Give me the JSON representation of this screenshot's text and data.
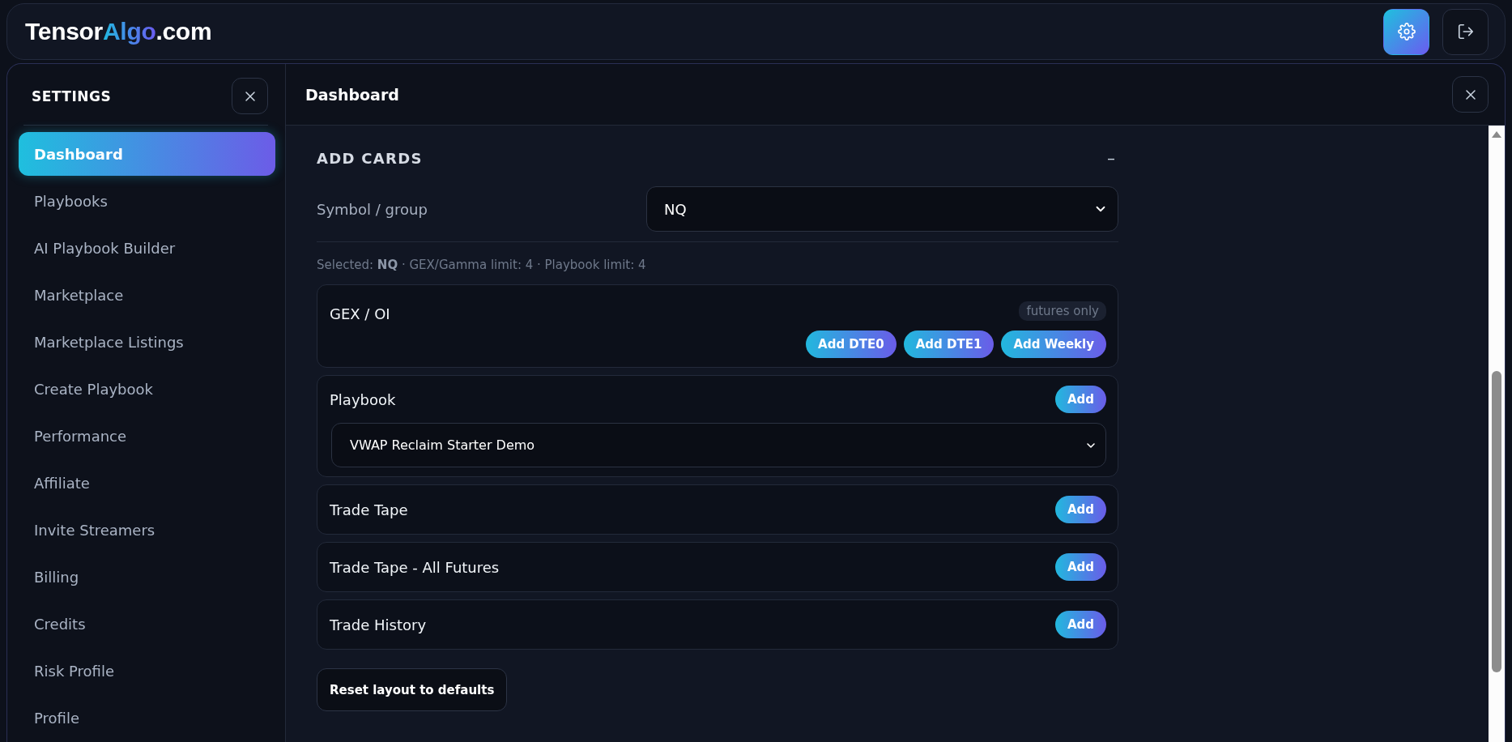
{
  "header": {
    "logo": [
      {
        "text": "Tensor",
        "kind": "plain"
      },
      {
        "text": "Algo",
        "kind": "accent"
      },
      {
        "text": ".com",
        "kind": "plain"
      }
    ],
    "buttons": [
      {
        "kind": "settings",
        "selected": true
      },
      {
        "kind": "logout",
        "selected": false
      }
    ]
  },
  "sidebar": {
    "title": "SETTINGS",
    "items": [
      {
        "label": "Dashboard",
        "selected": true
      },
      {
        "label": "Playbooks",
        "selected": false
      },
      {
        "label": "AI Playbook Builder",
        "selected": false
      },
      {
        "label": "Marketplace",
        "selected": false
      },
      {
        "label": "Marketplace Listings",
        "selected": false
      },
      {
        "label": "Create Playbook",
        "selected": false
      },
      {
        "label": "Performance",
        "selected": false
      },
      {
        "label": "Affiliate",
        "selected": false
      },
      {
        "label": "Invite Streamers",
        "selected": false
      },
      {
        "label": "Billing",
        "selected": false
      },
      {
        "label": "Credits",
        "selected": false
      },
      {
        "label": "Risk Profile",
        "selected": false
      },
      {
        "label": "Profile",
        "selected": false
      }
    ]
  },
  "main": {
    "title": "Dashboard",
    "section": {
      "title": "ADD CARDS",
      "toggle": "–",
      "symbol_field": {
        "label": "Symbol / group",
        "value": "NQ"
      },
      "info": "Selected: **NQ** · GEX/Gamma limit: 4 · Playbook limit: 4",
      "cards": [
        {
          "kind": "multi",
          "title": "GEX / OI",
          "badge": "futures only",
          "buttons": [
            "Add DTE0",
            "Add DTE1",
            "Add Weekly"
          ]
        },
        {
          "kind": "select",
          "title": "Playbook",
          "buttons": [
            "Add"
          ],
          "select_value": "VWAP Reclaim Starter Demo"
        },
        {
          "kind": "simple",
          "title": "Trade Tape",
          "buttons": [
            "Add"
          ]
        },
        {
          "kind": "simple",
          "title": "Trade Tape - All Futures",
          "buttons": [
            "Add"
          ]
        },
        {
          "kind": "simple",
          "title": "Trade History",
          "buttons": [
            "Add"
          ]
        }
      ],
      "reset_button": "Reset layout to defaults"
    }
  }
}
